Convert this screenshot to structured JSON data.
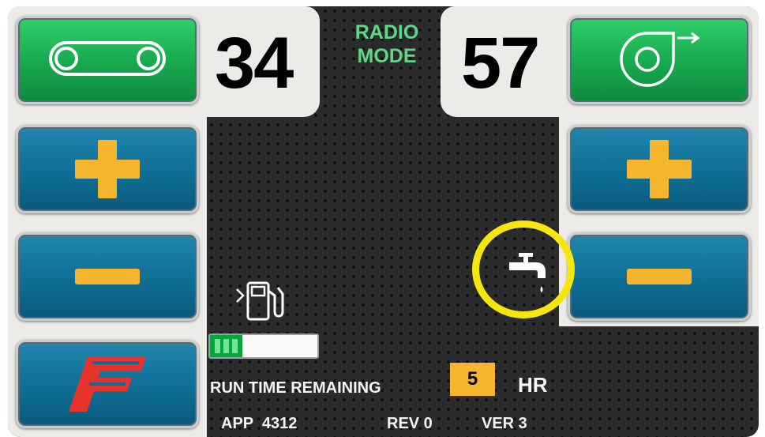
{
  "header": {
    "mode_line1": "RADIO",
    "mode_line2": "MODE"
  },
  "left": {
    "value": "34",
    "mode_button_icon": "conveyor-belt-icon",
    "increase_icon": "plus-icon",
    "decrease_icon": "minus-icon",
    "brand_icon": "f-logo-icon"
  },
  "right": {
    "value": "57",
    "mode_button_icon": "blower-fan-icon",
    "increase_icon": "plus-icon",
    "decrease_icon": "minus-icon"
  },
  "status": {
    "fuel_icon": "fuel-pump-icon",
    "fuel_level_fraction": 0.3,
    "water_icon": "water-faucet-icon",
    "run_time_label": "RUN TIME REMAINING",
    "run_time_value": "5",
    "run_time_unit": "HR"
  },
  "footer": {
    "app": "APP  4312",
    "rev": "REV 0",
    "ver": "VER 3"
  },
  "colors": {
    "green_button": "#18a84e",
    "blue_button": "#0f6e95",
    "accent_yellow": "#f6b52e",
    "mode_text": "#5fd68a",
    "highlight_ring": "#f5e60f",
    "logo_red": "#e8332d"
  }
}
